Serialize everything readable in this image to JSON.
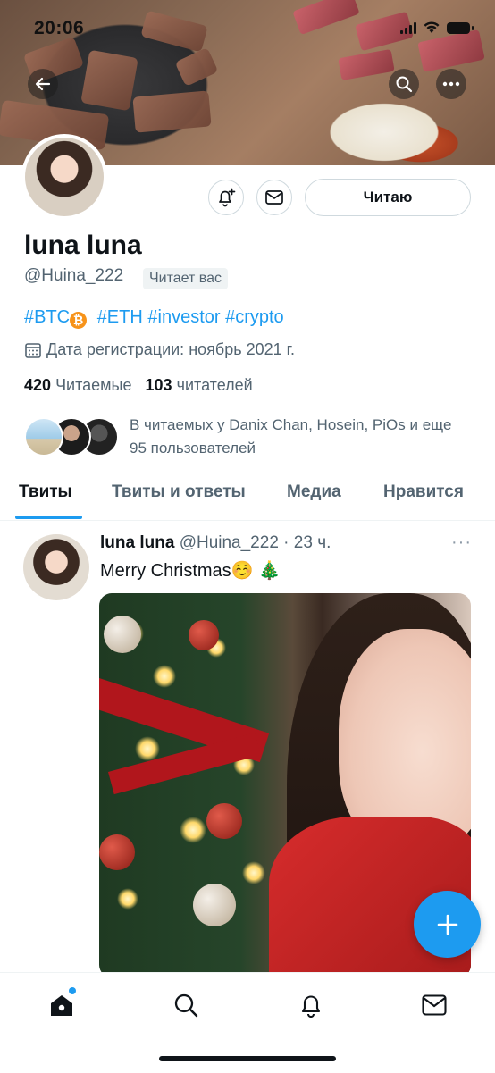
{
  "status_bar": {
    "time": "20:06"
  },
  "profile": {
    "follow_label": "Читаю",
    "name": "luna luna",
    "handle": "@Huina_222",
    "follows_you": "Читает вас",
    "bio_parts": [
      "#BTC",
      "#ETH",
      "#investor",
      "#crypto"
    ],
    "joined": "Дата регистрации: ноябрь 2021 г.",
    "following_count": "420",
    "following_label": "Читаемые",
    "followers_count": "103",
    "followers_label": "читателей",
    "followed_by": "В читаемых у Danix Chan, Hosein, PiOs и еще 95 пользователей"
  },
  "tabs": [
    {
      "label": "Твиты",
      "active": true
    },
    {
      "label": "Твиты и ответы",
      "active": false
    },
    {
      "label": "Медиа",
      "active": false
    },
    {
      "label": "Нравится",
      "active": false
    }
  ],
  "tweet": {
    "name": "luna luna",
    "handle": "@Huina_222",
    "time": "· 23 ч.",
    "text": "Merry Christmas☺️ 🎄",
    "more": "···"
  },
  "colors": {
    "accent": "#1d9bf0",
    "text": "#0f1419",
    "muted": "#536471",
    "btc": "#f7931a"
  },
  "icons": [
    "back-arrow-icon",
    "search-icon",
    "more-icon",
    "notification-bell-plus-icon",
    "mail-icon",
    "calendar-icon",
    "compose-plus-icon",
    "home-icon",
    "search-icon",
    "bell-icon",
    "mail-icon"
  ]
}
